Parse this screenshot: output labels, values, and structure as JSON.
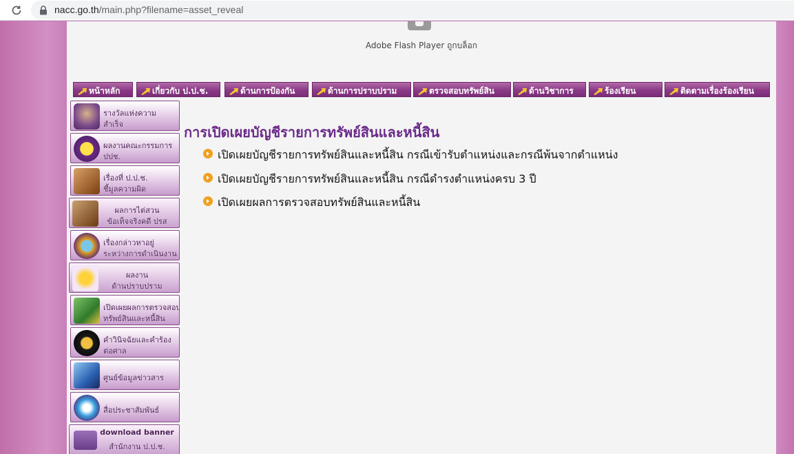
{
  "browser": {
    "url_host": "nacc.go.th",
    "url_path": "/main.php?filename=asset_reveal"
  },
  "flash": {
    "message": "Adobe Flash Player ถูกบล็อก"
  },
  "nav": [
    {
      "label": "หน้าหลัก"
    },
    {
      "label": "เกี่ยวกับ ป.ป.ช."
    },
    {
      "label": "ด้านการป้องกัน"
    },
    {
      "label": "ด้านการปราบปราม"
    },
    {
      "label": "ตรวจสอบทรัพย์สิน"
    },
    {
      "label": "ด้านวิชาการ"
    },
    {
      "label": "ร้องเรียน"
    },
    {
      "label": "ติดตามเรื่องร้องเรียน"
    }
  ],
  "menu": [
    {
      "line1": "รางวัลแห่งความ",
      "line2": "สำเร็จ",
      "icon": "trophy-icon"
    },
    {
      "line1": "ผลงานคณะกรรมการ",
      "line2": "ปปช.",
      "icon": "star-icon"
    },
    {
      "line1": "เรื่องที่ ป.ป.ช.",
      "line2": "ชี้มูลความผิด",
      "icon": "gavel-icon"
    },
    {
      "line1": "ผลการไต่สวน",
      "line2": "ข้อเท็จจริงคดี ปรส",
      "icon": "scales-icon"
    },
    {
      "line1": "เรื่องกล่าวหาอยู่",
      "line2": "ระหว่างการดำเนินงาน",
      "icon": "magnifier-icon"
    },
    {
      "line1": "ผลงาน",
      "line2": "ด้านปราบปราม",
      "icon": "emblem-icon"
    },
    {
      "line1": "เปิดเผยผลการตรวจสอบ",
      "line2": "ทรัพย์สินและหนี้สิน",
      "icon": "money-icon"
    },
    {
      "line1": "คำวินิจฉัยและคำร้อง",
      "line2": "ต่อศาล",
      "icon": "justice-icon"
    },
    {
      "line1": "ศูนย์ข้อมูลข่าวสาร",
      "line2": "",
      "icon": "computer-icon"
    },
    {
      "line1": "สื่อประชาสัมพันธ์",
      "line2": "",
      "icon": "media-icon"
    },
    {
      "line1": "download banner",
      "line2": "สำนักงาน ป.ป.ช.",
      "icon": "download-icon"
    }
  ],
  "content": {
    "title": "การเปิดเผยบัญชีรายการทรัพย์สินและหนี้สิน",
    "links": [
      "เปิดเผยบัญชีรายการทรัพย์สินและหนี้สิน กรณีเข้ารับตำแหน่งและกรณีพ้นจากตำแหน่ง",
      "เปิดเผยบัญชีรายการทรัพย์สินและหนี้สิน กรณีดำรงตำแหน่งครบ 3 ปี",
      "เปิดเผยผลการตรวจสอบทรัพย์สินและหนี้สิน"
    ]
  }
}
